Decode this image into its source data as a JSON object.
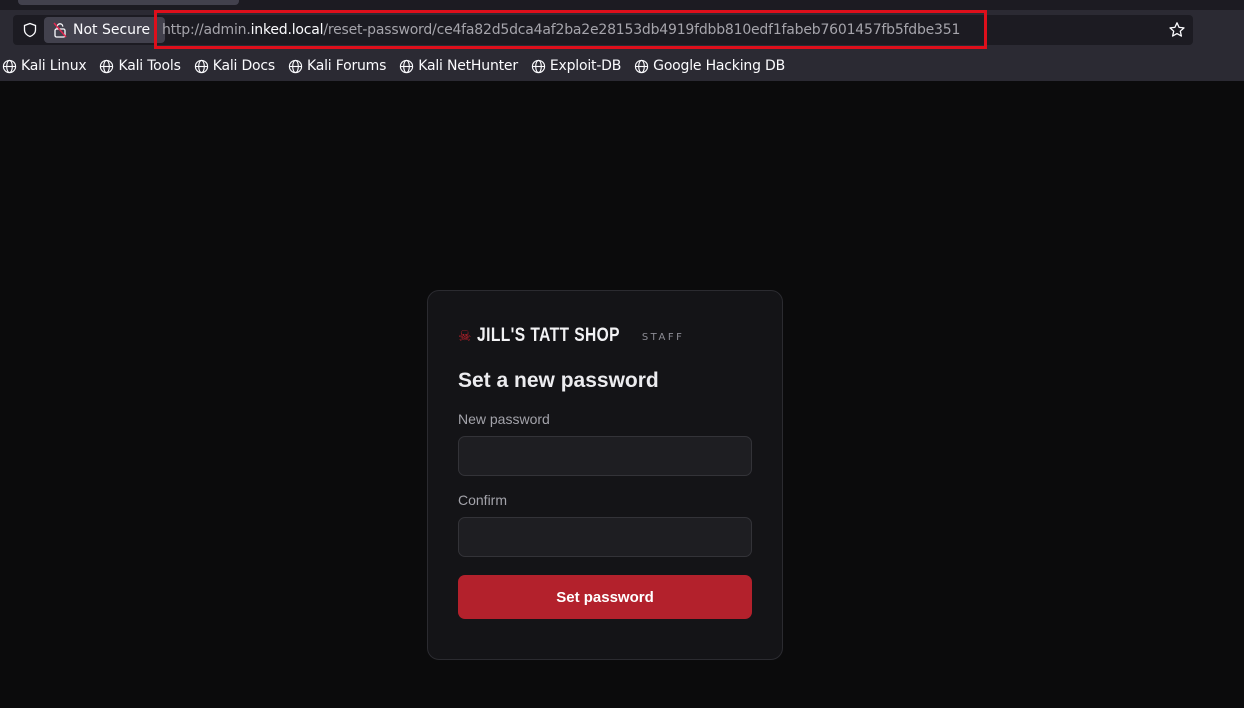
{
  "browser": {
    "security_label": "Not Secure",
    "url": {
      "scheme_and_subdomain": "http://admin.",
      "domain": "inked.local",
      "path": "/reset-password/ce4fa82d5dca4af2ba2e28153db4919fdbb810edf1fabeb7601457fb5fdbe351"
    },
    "bookmarks": [
      "Kali Linux",
      "Kali Tools",
      "Kali Docs",
      "Kali Forums",
      "Kali NetHunter",
      "Exploit-DB",
      "Google Hacking DB"
    ]
  },
  "page": {
    "brand": {
      "icon": "☠",
      "name": "JILL'S TATT SHOP",
      "tag": "STAFF"
    },
    "heading": "Set a new password",
    "fields": {
      "new_password_label": "New password",
      "confirm_label": "Confirm"
    },
    "submit_label": "Set password"
  },
  "colors": {
    "accent": "#b3212c",
    "url_highlight": "#dd0f1b",
    "background": "#0b0b0c"
  }
}
